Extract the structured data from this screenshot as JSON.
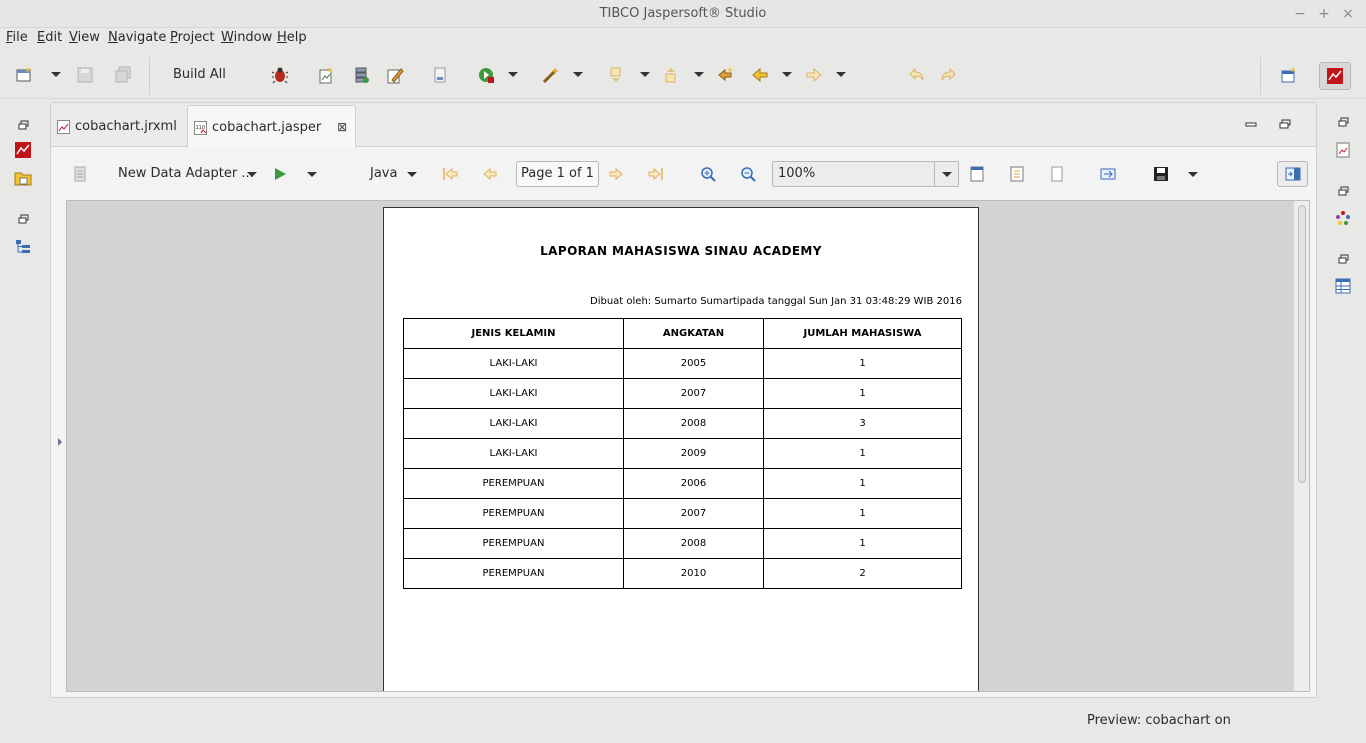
{
  "app": {
    "window_title": "TIBCO Jaspersoft® Studio"
  },
  "window_controls": {
    "minimize": "−",
    "maximize": "+",
    "close": "×"
  },
  "menu": [
    "File",
    "Edit",
    "View",
    "Navigate",
    "Project",
    "Window",
    "Help"
  ],
  "toolbar": {
    "build_all_label": "Build All"
  },
  "editor": {
    "tabs": [
      {
        "label": "cobachart.jrxml",
        "active": false
      },
      {
        "label": "cobachart.jasper",
        "active": true
      }
    ]
  },
  "report_toolbar": {
    "data_adapter": "New Data Adapter ...",
    "language": "Java",
    "page_indicator": "Page 1 of 1",
    "zoom": "100%"
  },
  "report": {
    "title": "LAPORAN MAHASISWA SINAU ACADEMY",
    "meta": "Dibuat oleh: Sumarto Sumartipada tanggal Sun Jan 31 03:48:29 WIB 2016",
    "columns": [
      "JENIS KELAMIN",
      "ANGKATAN",
      "JUMLAH MAHASISWA"
    ],
    "rows": [
      [
        "LAKI-LAKI",
        "2005",
        "1"
      ],
      [
        "LAKI-LAKI",
        "2007",
        "1"
      ],
      [
        "LAKI-LAKI",
        "2008",
        "3"
      ],
      [
        "LAKI-LAKI",
        "2009",
        "1"
      ],
      [
        "PEREMPUAN",
        "2006",
        "1"
      ],
      [
        "PEREMPUAN",
        "2007",
        "1"
      ],
      [
        "PEREMPUAN",
        "2008",
        "1"
      ],
      [
        "PEREMPUAN",
        "2010",
        "2"
      ]
    ]
  },
  "status": {
    "text": "Preview: cobachart on"
  },
  "colors": {
    "accent_red": "#c0141c",
    "run_green": "#3c9a3c",
    "arrow_orange": "#e1a23a",
    "icon_blue": "#3a6db5"
  }
}
